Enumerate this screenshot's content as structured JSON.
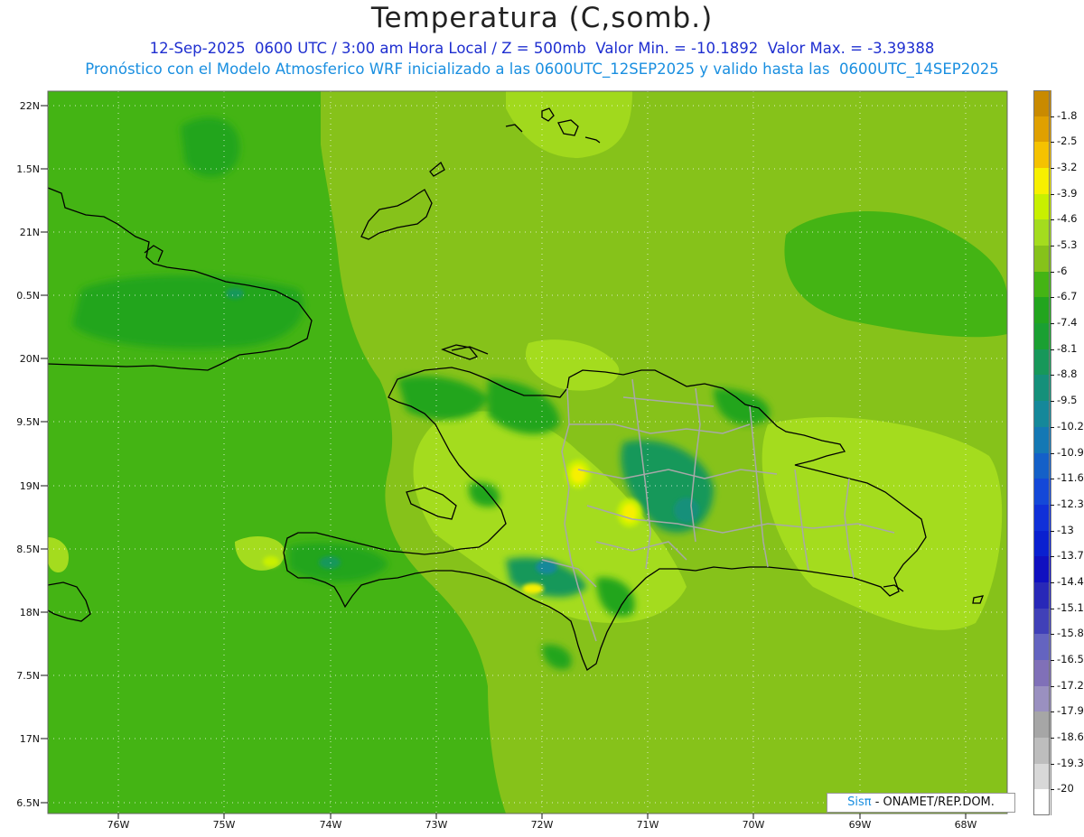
{
  "title": "Temperatura (C,somb.)",
  "subtitle_line1": "12-Sep-2025  0600 UTC / 3:00 am Hora Local / Z = 500mb  Valor Min. = -10.1892  Valor Max. = -3.39388",
  "subtitle_line2": "Pronóstico con el Modelo Atmosferico WRF inicializado a las 0600UTC_12SEP2025 y valido hasta las  0600UTC_14SEP2025",
  "credit": {
    "brand": "Sisπ",
    "text": " - ONAMET/REP.DOM."
  },
  "lat_labels": [
    "22N",
    "1.5N",
    "21N",
    "0.5N",
    "20N",
    "9.5N",
    "19N",
    "8.5N",
    "18N",
    "7.5N",
    "17N",
    "6.5N"
  ],
  "lon_labels": [
    "76W",
    "75W",
    "74W",
    "73W",
    "72W",
    "71W",
    "70W",
    "69W",
    "68W"
  ],
  "colorbar": {
    "labels": [
      "-1.8",
      "-2.5",
      "-3.2",
      "-3.9",
      "-4.6",
      "-5.3",
      "-6",
      "-6.7",
      "-7.4",
      "-8.1",
      "-8.8",
      "-9.5",
      "-10.2",
      "-10.9",
      "-11.6",
      "-12.3",
      "-13",
      "-13.7",
      "-14.4",
      "-15.1",
      "-15.8",
      "-16.5",
      "-17.2",
      "-17.9",
      "-18.6",
      "-19.3",
      "-20"
    ],
    "colors": [
      "#c98a00",
      "#e0a000",
      "#f5c200",
      "#f7f000",
      "#c8f000",
      "#a4dc1e",
      "#86c21a",
      "#44b414",
      "#22a51e",
      "#1aa032",
      "#17985a",
      "#15907a",
      "#15889a",
      "#1478b4",
      "#1460c8",
      "#1448d8",
      "#1030d8",
      "#0a20d0",
      "#1010c0",
      "#2828b8",
      "#4040b8",
      "#6464c0",
      "#8070b8",
      "#9a90c0",
      "#a6a6a6",
      "#bdbdbd",
      "#d8d8d8",
      "#ffffff"
    ]
  },
  "colors": {
    "field_base": "#44b414",
    "field_mid": "#86c21a",
    "field_warm": "#a4dc1e",
    "field_cool": "#22a51e",
    "field_yellow": "#f7f000",
    "coast": "#000000",
    "borders": "#a8a8a8"
  }
}
